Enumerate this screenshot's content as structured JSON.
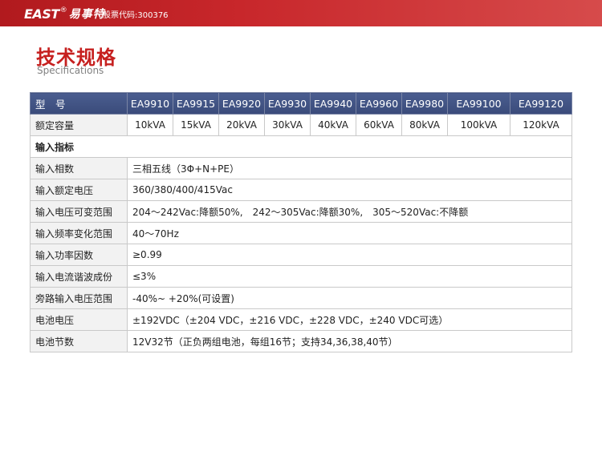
{
  "header": {
    "logo_text": "EAST",
    "logo_mark": "®",
    "logo_cn": "易事特",
    "stock_code": "股票代码:300376"
  },
  "title": "技术规格",
  "subtitle": "Specifications",
  "table": {
    "model_label": "型　号",
    "models": [
      "EA9910",
      "EA9915",
      "EA9920",
      "EA9930",
      "EA9940",
      "EA9960",
      "EA9980",
      "EA99100",
      "EA99120"
    ],
    "capacity_label": "额定容量",
    "capacities": [
      "10kVA",
      "15kVA",
      "20kVA",
      "30kVA",
      "40kVA",
      "60kVA",
      "80kVA",
      "100kVA",
      "120kVA"
    ],
    "section_input": "输入指标",
    "rows": [
      {
        "label": "输入相数",
        "value": "三相五线（3Φ+N+PE）"
      },
      {
        "label": "输入额定电压",
        "value": "360/380/400/415Vac"
      },
      {
        "label": "输入电压可变范围",
        "value": "204～242Vac:降额50%,　242～305Vac:降额30%,　305～520Vac:不降额"
      },
      {
        "label": "输入频率变化范围",
        "value": "40～70Hz"
      },
      {
        "label": "输入功率因数",
        "value": "≥0.99"
      },
      {
        "label": "输入电流谐波成份",
        "value": "≤3%"
      },
      {
        "label": "旁路输入电压范围",
        "value": "-40%~ +20%(可设置)"
      },
      {
        "label": "电池电压",
        "value": "±192VDC（±204 VDC，±216 VDC，±228 VDC，±240 VDC可选）"
      },
      {
        "label": "电池节数",
        "value": "12V32节（正负两组电池，每组16节；支持34,36,38,40节）"
      }
    ]
  }
}
